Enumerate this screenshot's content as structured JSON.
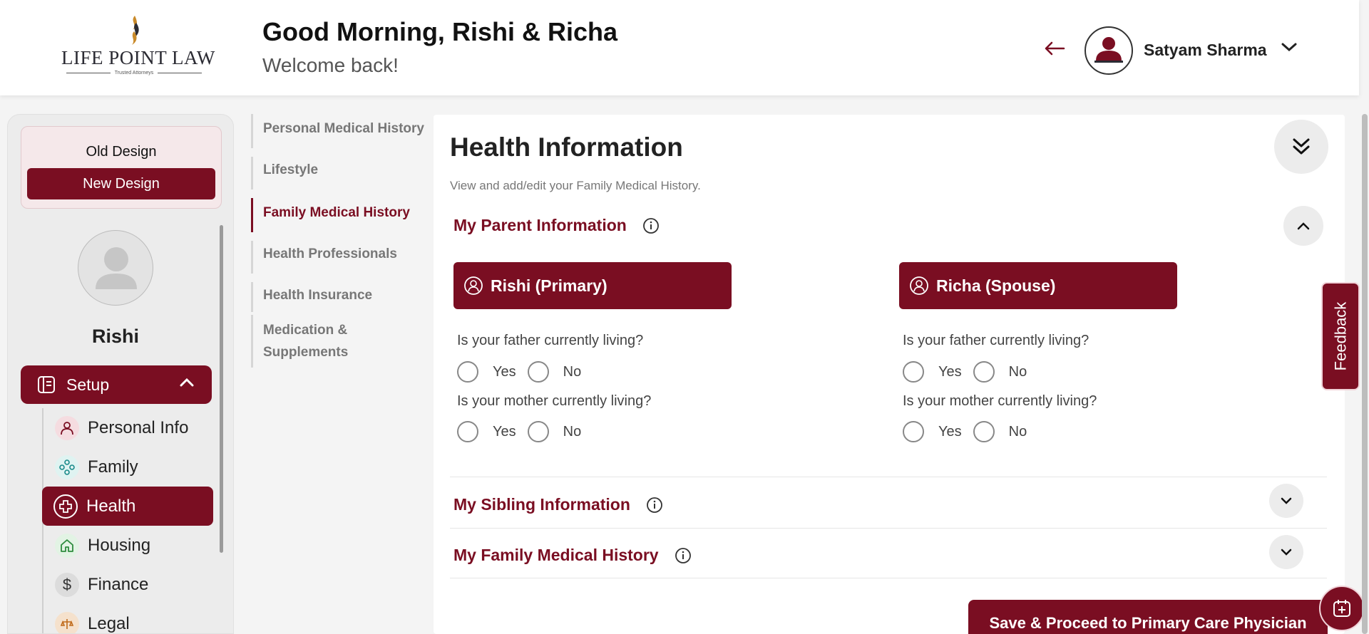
{
  "header": {
    "logo_text": "LIFE POINT LAW",
    "logo_tagline": "Trusted Attorneys",
    "greeting": "Good Morning, Rishi & Richa",
    "subtitle": "Welcome back!",
    "user_name": "Satyam Sharma"
  },
  "sidebar": {
    "old_design": "Old Design",
    "new_design": "New Design",
    "profile_name": "Rishi",
    "setup_label": "Setup",
    "items": [
      {
        "label": "Personal Info",
        "icon": "person-icon",
        "color": "#7a0e22"
      },
      {
        "label": "Family",
        "icon": "family-icon",
        "color": "#1a8a8a"
      },
      {
        "label": "Health",
        "icon": "health-plus-icon",
        "color": "#ffffff"
      },
      {
        "label": "Housing",
        "icon": "home-icon",
        "color": "#2e8b3e"
      },
      {
        "label": "Finance",
        "icon": "dollar-icon",
        "color": "#333333"
      },
      {
        "label": "Legal",
        "icon": "legal-icon",
        "color": "#c06a1a"
      }
    ]
  },
  "subnav": {
    "items": [
      "Personal Medical History",
      "Lifestyle",
      "Family Medical History",
      "Health Professionals",
      "Health Insurance",
      "Medication & Supplements"
    ],
    "active": "Family Medical History"
  },
  "main": {
    "title": "Health Information",
    "subtitle": "View and add/edit your Family Medical History.",
    "sections": {
      "parent": "My Parent Information",
      "sibling": "My Sibling Information",
      "family_history": "My Family Medical History"
    },
    "persons": [
      {
        "name": "Rishi (Primary)"
      },
      {
        "name": "Richa (Spouse)"
      }
    ],
    "questions": {
      "father": "Is your father currently living?",
      "mother": "Is your mother currently living?"
    },
    "options": {
      "yes": "Yes",
      "no": "No"
    }
  },
  "feedback_label": "Feedback",
  "save_button": "Save & Proceed to Primary Care Physician",
  "colors": {
    "brand": "#7a0e22",
    "surface": "#ececec"
  }
}
